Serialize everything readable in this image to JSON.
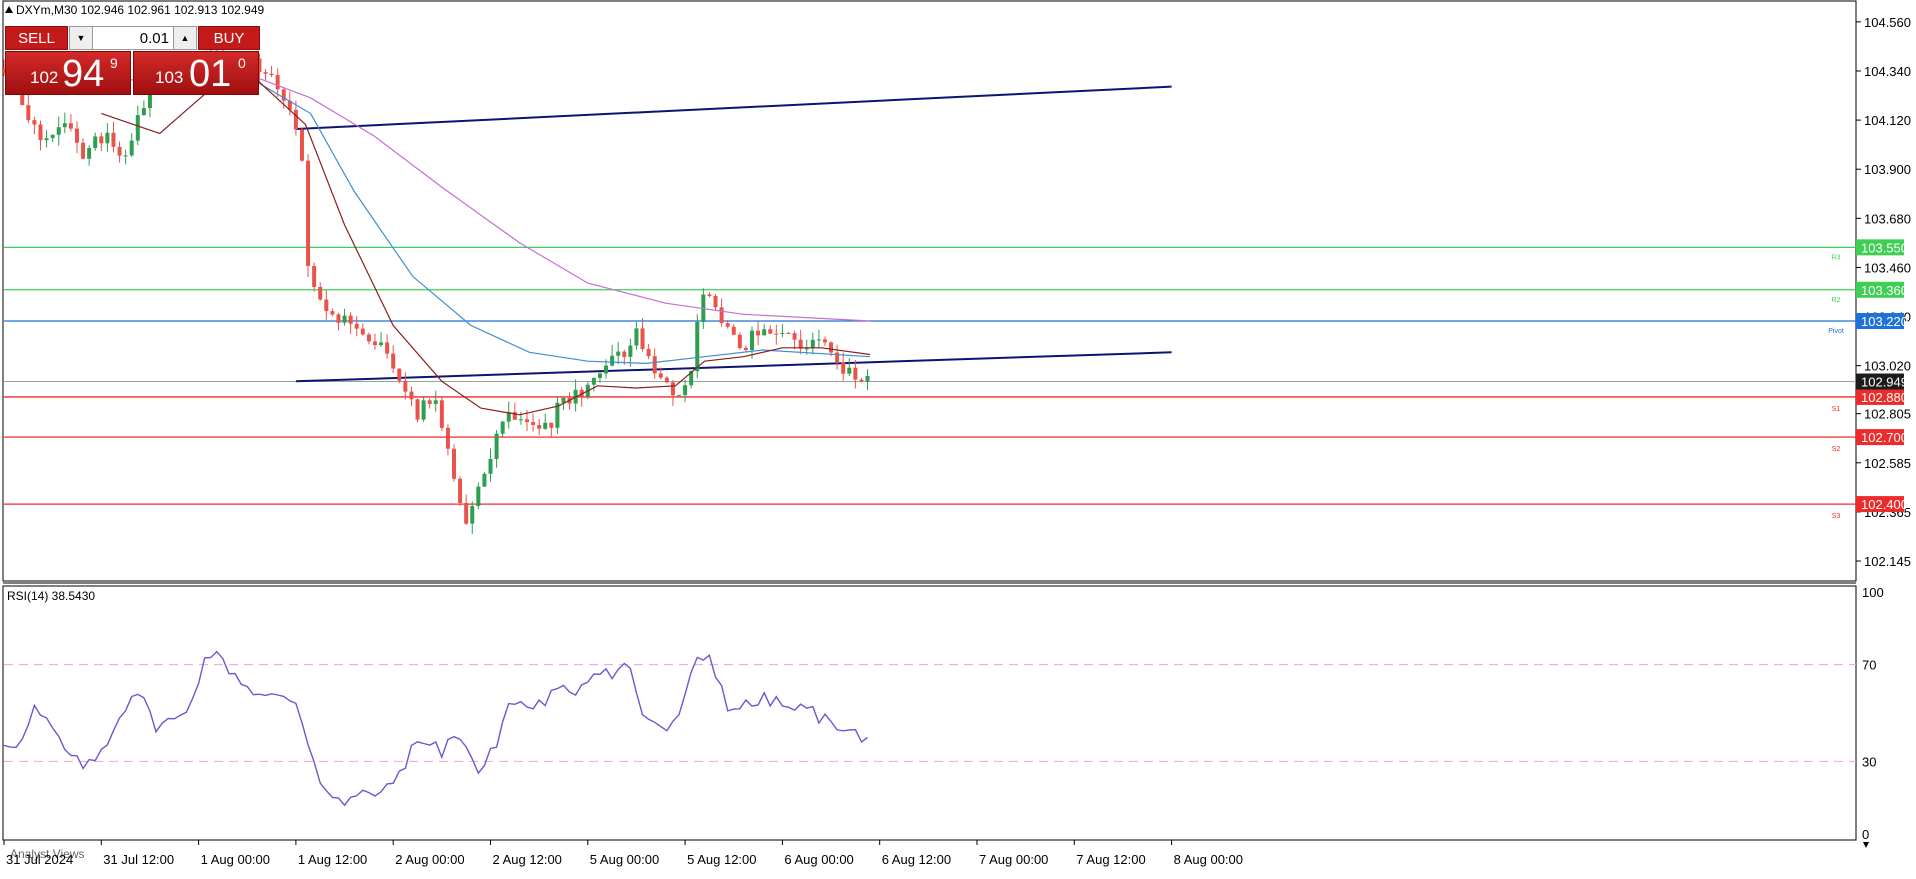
{
  "header": {
    "symbol_info": "DXYm,M30  102.946 102.961 102.913 102.949"
  },
  "trade_panel": {
    "sell_label": "SELL",
    "buy_label": "BUY",
    "lot": "0.01",
    "bid_small": "102",
    "bid_big": "94",
    "bid_sup": "9",
    "ask_small": "103",
    "ask_big": "01",
    "ask_sup": "0"
  },
  "rsi_label": "RSI(14) 38.5430",
  "analyst_label": "Analyst Views",
  "colors": {
    "bull": "#2e9e4f",
    "bear": "#e8534a",
    "ma_fast": "#8b1e1e",
    "ma_mid": "#3d8fd0",
    "ma_slow": "#c56fd3",
    "trend": "#0b1470",
    "resistance": "#3fcf55",
    "support": "#ee2b2b",
    "pivot": "#1e72d8",
    "rsi": "#6e56cf",
    "rsi_levels": "#e8a0e8"
  },
  "chart_data": [
    {
      "type": "candlestick",
      "symbol": "DXYm",
      "timeframe": "M30",
      "ylim": [
        102.06,
        104.64
      ],
      "y_ticks": [
        "104.560",
        "104.340",
        "104.120",
        "103.900",
        "103.680",
        "103.460",
        "103.240",
        "103.020",
        "102.805",
        "102.585",
        "102.365",
        "102.145"
      ],
      "x_ticks": [
        "31 Jul 2024",
        "31 Jul 12:00",
        "1 Aug 00:00",
        "1 Aug 12:00",
        "2 Aug 00:00",
        "2 Aug 12:00",
        "5 Aug 00:00",
        "5 Aug 12:00",
        "6 Aug 00:00",
        "6 Aug 12:00",
        "7 Aug 00:00",
        "7 Aug 12:00",
        "8 Aug 00:00"
      ],
      "levels": [
        {
          "name": "R3",
          "value": 103.55,
          "label": "103.550",
          "kind": "resistance"
        },
        {
          "name": "R2",
          "value": 103.36,
          "label": "103.360",
          "kind": "resistance"
        },
        {
          "name": "Pivot",
          "value": 103.22,
          "label": "103.220",
          "kind": "pivot"
        },
        {
          "name": "S1",
          "value": 102.88,
          "label": "102.880",
          "kind": "support"
        },
        {
          "name": "S2",
          "value": 102.7,
          "label": "102.700",
          "kind": "support"
        },
        {
          "name": "S3",
          "value": 102.4,
          "label": "102.400",
          "kind": "support"
        }
      ],
      "current_price": {
        "value": 102.949,
        "label": "102.949"
      },
      "trendlines": [
        {
          "from": [
            3.0,
            104.08
          ],
          "to": [
            12.0,
            104.27
          ]
        },
        {
          "from": [
            3.0,
            102.95
          ],
          "to": [
            12.0,
            103.08
          ]
        }
      ],
      "close_path": [
        [
          0.0,
          104.35
        ],
        [
          0.1,
          104.3
        ],
        [
          0.25,
          104.15
        ],
        [
          0.42,
          104.0
        ],
        [
          0.6,
          104.12
        ],
        [
          0.8,
          103.96
        ],
        [
          1.0,
          104.05
        ],
        [
          1.1,
          104.02
        ],
        [
          1.22,
          103.95
        ],
        [
          1.35,
          104.1
        ],
        [
          1.55,
          104.3
        ],
        [
          1.75,
          104.38
        ],
        [
          1.95,
          104.33
        ],
        [
          2.15,
          104.42
        ],
        [
          2.4,
          104.36
        ],
        [
          2.6,
          104.38
        ],
        [
          2.85,
          104.25
        ],
        [
          3.05,
          104.05
        ],
        [
          3.1,
          103.55
        ],
        [
          3.2,
          103.35
        ],
        [
          3.4,
          103.25
        ],
        [
          3.6,
          103.18
        ],
        [
          3.9,
          103.1
        ],
        [
          4.1,
          102.92
        ],
        [
          4.25,
          102.8
        ],
        [
          4.4,
          102.9
        ],
        [
          4.55,
          102.65
        ],
        [
          4.75,
          102.28
        ],
        [
          4.85,
          102.45
        ],
        [
          5.05,
          102.68
        ],
        [
          5.15,
          102.82
        ],
        [
          5.4,
          102.78
        ],
        [
          5.6,
          102.75
        ],
        [
          5.75,
          102.88
        ],
        [
          6.0,
          102.9
        ],
        [
          6.2,
          103.05
        ],
        [
          6.4,
          103.1
        ],
        [
          6.5,
          103.16
        ],
        [
          6.7,
          102.95
        ],
        [
          6.9,
          102.9
        ],
        [
          7.05,
          102.95
        ],
        [
          7.15,
          103.3
        ],
        [
          7.25,
          103.35
        ],
        [
          7.4,
          103.22
        ],
        [
          7.6,
          103.1
        ],
        [
          7.8,
          103.2
        ],
        [
          8.0,
          103.15
        ],
        [
          8.2,
          103.12
        ],
        [
          8.45,
          103.1
        ],
        [
          8.65,
          103.0
        ],
        [
          8.8,
          102.95
        ],
        [
          8.9,
          102.95
        ]
      ],
      "moving_averages": [
        {
          "key": "ma_slow",
          "points": [
            [
              0.3,
              104.3
            ],
            [
              1.5,
              104.3
            ],
            [
              2.6,
              104.31
            ],
            [
              3.15,
              104.22
            ],
            [
              3.8,
              104.05
            ],
            [
              4.5,
              103.82
            ],
            [
              5.3,
              103.57
            ],
            [
              6.0,
              103.39
            ],
            [
              6.8,
              103.3
            ],
            [
              7.6,
              103.25
            ],
            [
              8.9,
              103.22
            ]
          ]
        },
        {
          "key": "ma_mid",
          "points": [
            [
              1.5,
              104.24
            ],
            [
              2.6,
              104.29
            ],
            [
              3.15,
              104.15
            ],
            [
              3.6,
              103.8
            ],
            [
              4.2,
              103.42
            ],
            [
              4.8,
              103.2
            ],
            [
              5.4,
              103.08
            ],
            [
              6.0,
              103.04
            ],
            [
              6.6,
              103.03
            ],
            [
              7.2,
              103.06
            ],
            [
              7.8,
              103.09
            ],
            [
              8.9,
              103.06
            ]
          ]
        },
        {
          "key": "ma_fast",
          "points": [
            [
              1.0,
              104.15
            ],
            [
              1.6,
              104.06
            ],
            [
              2.1,
              104.25
            ],
            [
              2.6,
              104.3
            ],
            [
              3.1,
              104.1
            ],
            [
              3.5,
              103.65
            ],
            [
              4.0,
              103.2
            ],
            [
              4.5,
              102.95
            ],
            [
              4.9,
              102.83
            ],
            [
              5.3,
              102.8
            ],
            [
              5.7,
              102.84
            ],
            [
              6.1,
              102.93
            ],
            [
              6.5,
              102.92
            ],
            [
              6.9,
              102.93
            ],
            [
              7.2,
              103.04
            ],
            [
              7.6,
              103.06
            ],
            [
              8.0,
              103.1
            ],
            [
              8.4,
              103.1
            ],
            [
              8.9,
              103.07
            ]
          ]
        }
      ],
      "candle_seed": 20240808
    },
    {
      "type": "line",
      "title": "RSI(14) 38.5430",
      "ylim": [
        0,
        100
      ],
      "y_ticks": [
        "100",
        "70",
        "30",
        "0"
      ],
      "levels": [
        70,
        30
      ],
      "points": [
        [
          0.0,
          38
        ],
        [
          0.2,
          38
        ],
        [
          0.3,
          52
        ],
        [
          0.5,
          43
        ],
        [
          0.7,
          30
        ],
        [
          0.9,
          28
        ],
        [
          1.05,
          38
        ],
        [
          1.35,
          61
        ],
        [
          1.55,
          45
        ],
        [
          1.85,
          48
        ],
        [
          2.1,
          76
        ],
        [
          2.25,
          71
        ],
        [
          2.5,
          61
        ],
        [
          2.65,
          57
        ],
        [
          3.0,
          55
        ],
        [
          3.25,
          22
        ],
        [
          3.5,
          12
        ],
        [
          3.65,
          16
        ],
        [
          3.95,
          18
        ],
        [
          4.2,
          35
        ],
        [
          4.4,
          40
        ],
        [
          4.5,
          32
        ],
        [
          4.65,
          44
        ],
        [
          4.9,
          24
        ],
        [
          5.05,
          37
        ],
        [
          5.2,
          55
        ],
        [
          5.45,
          52
        ],
        [
          5.65,
          58
        ],
        [
          5.9,
          60
        ],
        [
          6.1,
          69
        ],
        [
          6.3,
          66
        ],
        [
          6.4,
          73
        ],
        [
          6.55,
          50
        ],
        [
          6.85,
          42
        ],
        [
          7.0,
          56
        ],
        [
          7.1,
          70
        ],
        [
          7.25,
          74
        ],
        [
          7.45,
          52
        ],
        [
          7.65,
          53
        ],
        [
          7.85,
          56
        ],
        [
          8.05,
          52
        ],
        [
          8.3,
          51
        ],
        [
          8.5,
          45
        ],
        [
          8.7,
          45
        ],
        [
          8.8,
          38
        ],
        [
          8.9,
          40
        ]
      ]
    }
  ]
}
